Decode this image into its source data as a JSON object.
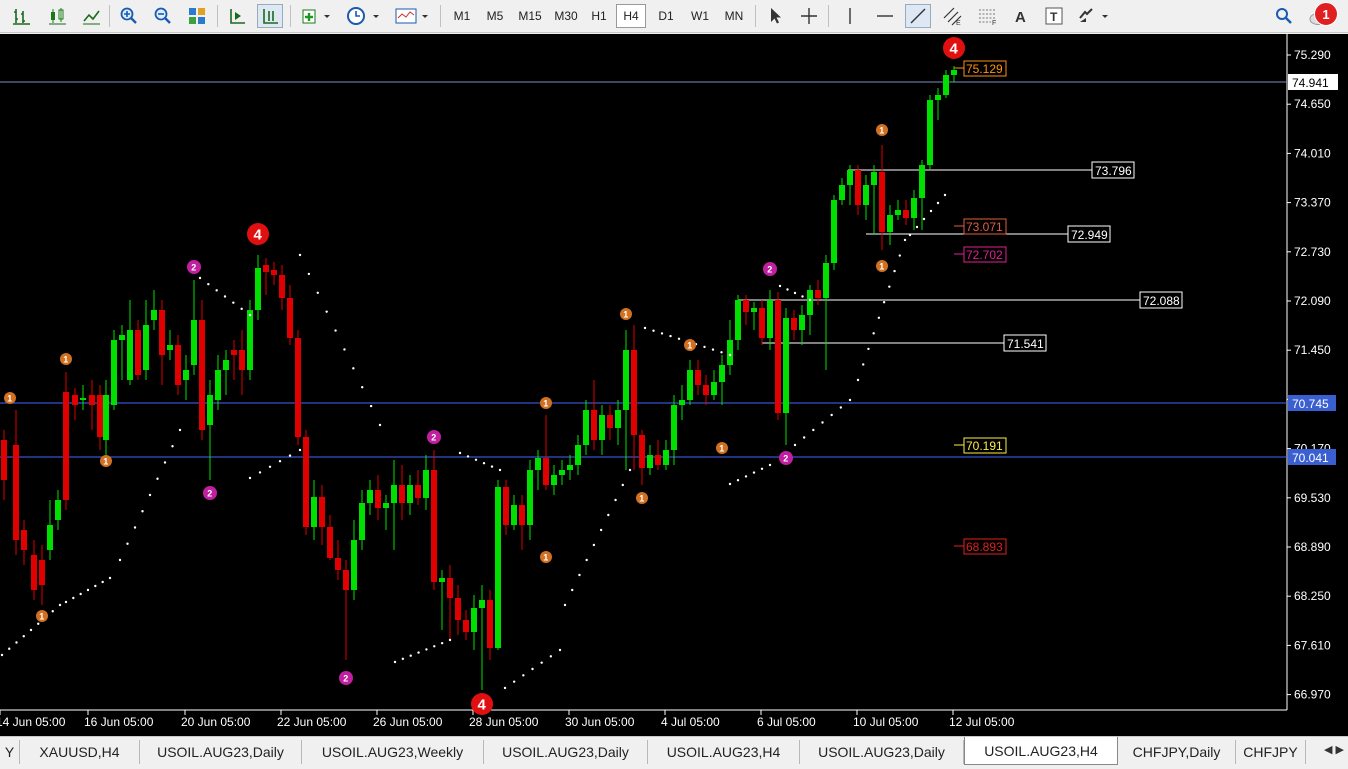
{
  "toolbar": {
    "timeframes": [
      "M1",
      "M5",
      "M15",
      "M30",
      "H1",
      "H4",
      "D1",
      "W1",
      "MN"
    ],
    "active_timeframe": "H4",
    "notification_count": "1"
  },
  "chart": {
    "price_ticks": [
      "75.290",
      "74.650",
      "74.010",
      "73.370",
      "72.730",
      "72.090",
      "71.450",
      "70.810",
      "70.170",
      "69.530",
      "68.890",
      "68.250",
      "67.610",
      "66.970"
    ],
    "time_ticks": [
      "14 Jun 05:00",
      "16 Jun 05:00",
      "20 Jun 05:00",
      "22 Jun 05:00",
      "26 Jun 05:00",
      "28 Jun 05:00",
      "30 Jun 05:00",
      "4 Jul 05:00",
      "6 Jul 05:00",
      "10 Jul 05:00",
      "12 Jul 05:00"
    ],
    "current_price": "74.941",
    "hlines": [
      {
        "label": "70.745",
        "color": "#4466ff"
      },
      {
        "label": "70.041",
        "color": "#4466ff"
      }
    ],
    "level_labels": [
      {
        "label": "73.796",
        "style": "white"
      },
      {
        "label": "72.949",
        "style": "white"
      },
      {
        "label": "72.088",
        "style": "white"
      },
      {
        "label": "71.541",
        "style": "white"
      },
      {
        "label": "75.129",
        "style": "orange"
      },
      {
        "label": "73.071",
        "style": "red"
      },
      {
        "label": "72.702",
        "style": "magenta"
      },
      {
        "label": "70.191",
        "style": "yellow"
      },
      {
        "label": "68.893",
        "style": "red"
      }
    ],
    "markers": [
      "4",
      "4",
      "4",
      "2",
      "2",
      "2",
      "2",
      "2",
      "2",
      "1",
      "1",
      "1",
      "1",
      "1",
      "1",
      "1",
      "1",
      "1",
      "1",
      "1",
      "1"
    ],
    "colors": {
      "bull": "#00e000",
      "bear": "#e00000",
      "current_line": "#7f8fbf"
    }
  },
  "tabs": [
    "Y",
    "XAUUSD,H4",
    "USOIL.AUG23,Daily",
    "USOIL.AUG23,Weekly",
    "USOIL.AUG23,Daily",
    "USOIL.AUG23,H4",
    "USOIL.AUG23,Daily",
    "USOIL.AUG23,H4",
    "CHFJPY,Daily",
    "CHFJPY"
  ],
  "active_tab_index": 7
}
